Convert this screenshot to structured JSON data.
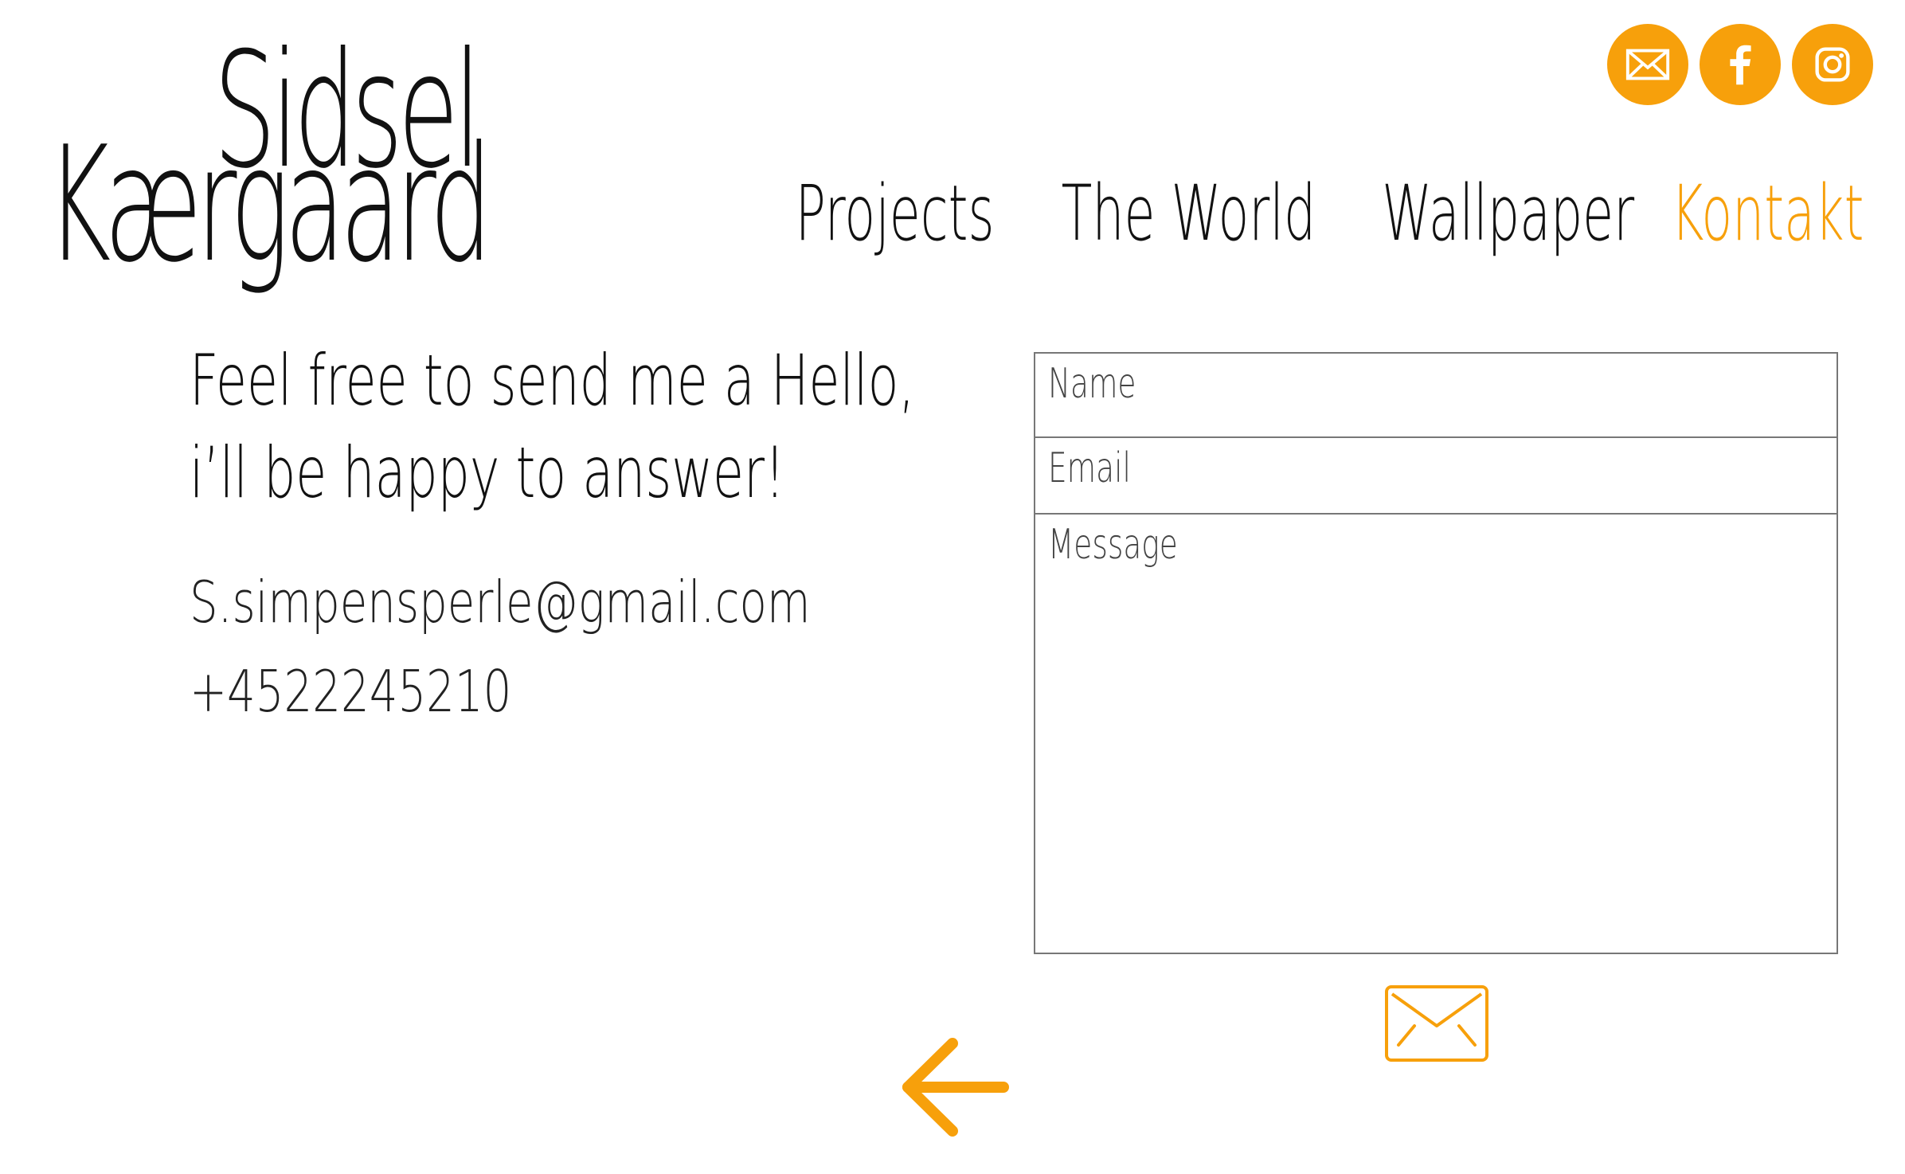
{
  "brand": {
    "first_name": "Sidsel",
    "last_name": "Kærgaard"
  },
  "social": [
    {
      "icon": "mail-icon",
      "label": "Email"
    },
    {
      "icon": "facebook-icon",
      "label": "Facebook"
    },
    {
      "icon": "instagram-icon",
      "label": "Instagram"
    }
  ],
  "nav": {
    "items": [
      {
        "label": "Projects",
        "active": false
      },
      {
        "label": "The World",
        "active": false
      },
      {
        "label": "Wallpaper",
        "active": false
      },
      {
        "label": "Kontakt",
        "active": true
      }
    ]
  },
  "intro": {
    "line1": "Feel free to send me a Hello,",
    "line2": "i’ll be happy to answer!"
  },
  "contact": {
    "email": "S.simpensperle@gmail.com",
    "phone": "+4522245210"
  },
  "form": {
    "name_placeholder": "Name",
    "email_placeholder": "Email",
    "message_placeholder": "Message",
    "name_value": "",
    "email_value": "",
    "message_value": ""
  },
  "actions": {
    "send_icon": "envelope-icon",
    "back_icon": "arrow-left-icon"
  },
  "colors": {
    "accent": "#f7a00b",
    "text": "#111111",
    "border": "#777777"
  }
}
